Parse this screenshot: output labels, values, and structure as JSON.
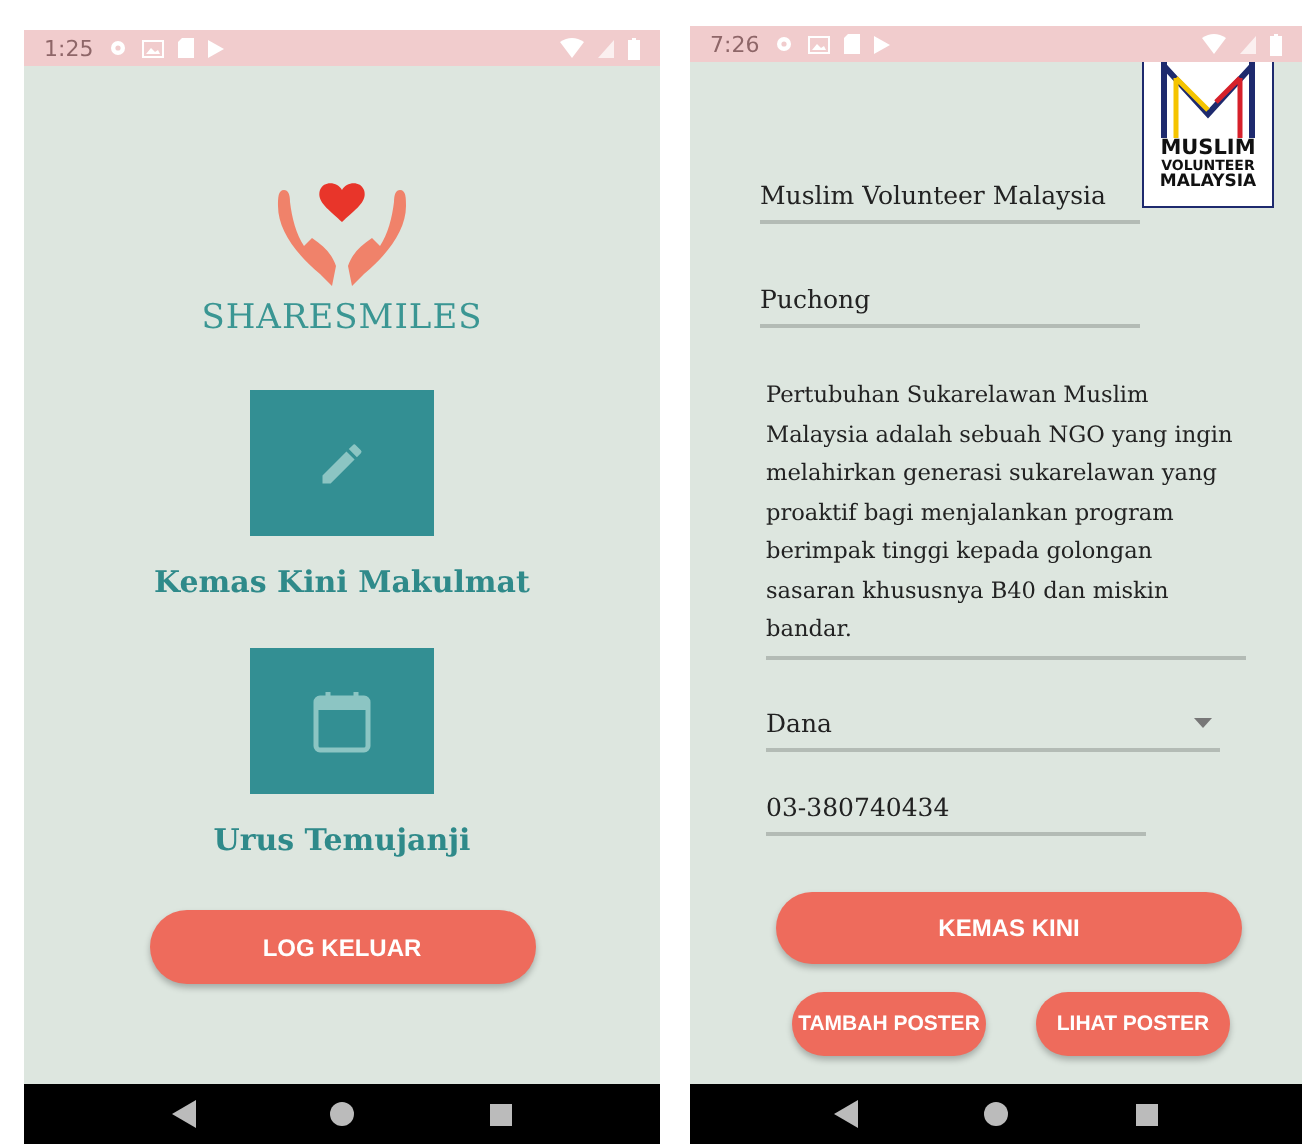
{
  "home_screen": {
    "status_bar": {
      "time": "1:25"
    },
    "app_title": "SHARESMILES",
    "menu": [
      {
        "kind": "edit",
        "label": "Kemas Kini Makulmat"
      },
      {
        "kind": "calendar",
        "label": "Urus Temujanji"
      }
    ],
    "logout_button": "LOG KELUAR"
  },
  "profile_screen": {
    "status_bar": {
      "time": "7:26"
    },
    "logo_lines": [
      "MUSLIM",
      "VOLUNTEER",
      "MALAYSIA"
    ],
    "fields": [
      {
        "kind": "text",
        "value": "Muslim Volunteer Malaysia"
      },
      {
        "kind": "text",
        "value": "Puchong"
      },
      {
        "kind": "multiline",
        "value": "Pertubuhan Sukarelawan Muslim Malaysia adalah sebuah NGO yang ingin melahirkan generasi sukarelawan yang proaktif bagi menjalankan program berimpak tinggi kepada golongan sasaran khususnya B40 dan miskin bandar."
      },
      {
        "kind": "dropdown",
        "value": "Dana"
      },
      {
        "kind": "phone",
        "value": "03-380740434"
      }
    ],
    "update_button": "KEMAS KINI",
    "poster_buttons": [
      "TAMBAH POSTER",
      "LIHAT POSTER"
    ]
  }
}
